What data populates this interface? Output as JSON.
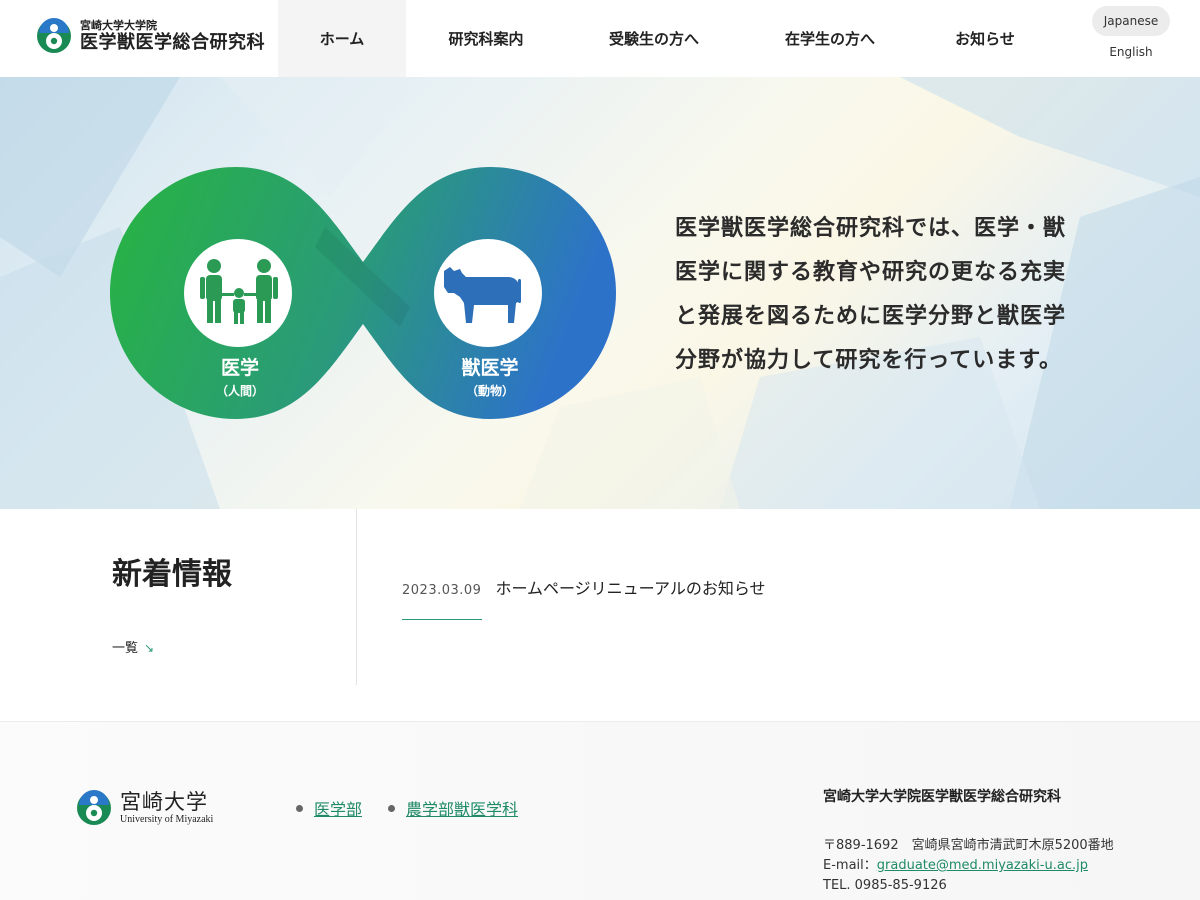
{
  "header": {
    "logo_sub": "宮崎大学大学院",
    "logo_main": "医学獣医学総合研究科",
    "nav": [
      {
        "label": "ホーム",
        "active": true
      },
      {
        "label": "研究科案内"
      },
      {
        "label": "受験生の方へ"
      },
      {
        "label": "在学生の方へ"
      },
      {
        "label": "お知らせ"
      }
    ],
    "lang": {
      "japanese": "Japanese",
      "english": "English"
    }
  },
  "hero": {
    "left_label": "医学",
    "left_sub": "（人間）",
    "right_label": "獣医学",
    "right_sub": "（動物）",
    "lines": [
      "医学獣医学総合研究科では、医学・獣",
      "医学に関する教育や研究の更なる充実",
      "と発展を図るために医学分野と獣医学",
      "分野が協力して研究を行っています。"
    ],
    "colors": {
      "green": "#27b440",
      "teal": "#2a9a7a",
      "blue": "#2d72c9"
    },
    "icons": [
      "family-icon",
      "cow-icon"
    ]
  },
  "news": {
    "title": "新着情報",
    "all_label": "一覧",
    "items": [
      {
        "date": "2023.03.09",
        "title": "ホームページリニューアルのお知らせ"
      }
    ]
  },
  "footer": {
    "logo_main": "宮崎大学",
    "logo_en": "University of Miyazaki",
    "links": [
      "医学部",
      "農学部獣医学科"
    ],
    "org": "宮崎大学大学院医学獣医学総合研究科",
    "address": "〒889-1692　宮崎県宮崎市清武町木原5200番地",
    "email_label": "E-mail：",
    "email": "graduate@med.miyazaki-u.ac.jp",
    "tel": "TEL. 0985-85-9126"
  }
}
